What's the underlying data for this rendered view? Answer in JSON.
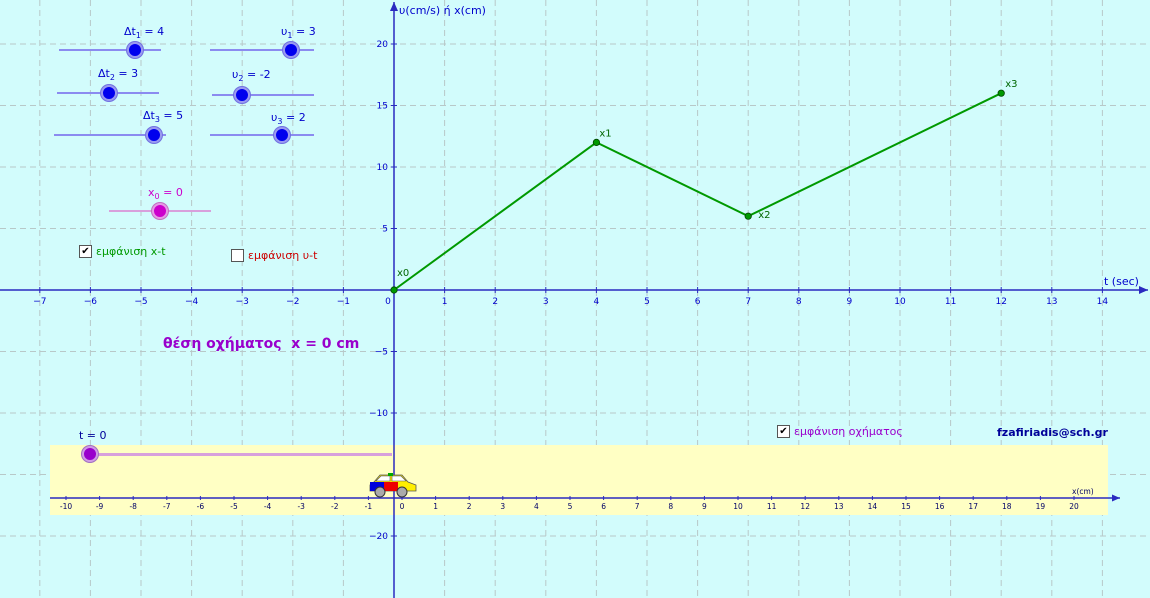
{
  "graph": {
    "y_axis_label": "υ(cm/s) ή x(cm)",
    "x_axis_label": "t (sec)",
    "x_ticks": [
      "−7",
      "−6",
      "−5",
      "−4",
      "−3",
      "−2",
      "−1",
      "0",
      "1",
      "2",
      "3",
      "4",
      "5",
      "6",
      "7",
      "8",
      "9",
      "10",
      "11",
      "12",
      "13",
      "14"
    ],
    "y_ticks": [
      "20",
      "15",
      "10",
      "5",
      "−5",
      "−10",
      "−20"
    ],
    "line_color": "#009900",
    "axis_color": "#2a2ac0",
    "background": "#d2fcfc"
  },
  "chart_data": {
    "type": "line",
    "x": [
      0,
      4,
      7,
      12
    ],
    "y": [
      0,
      12,
      6,
      16
    ],
    "point_labels": [
      "x0",
      "x1",
      "x2",
      "x3"
    ],
    "xlabel": "t (sec)",
    "ylabel": "υ(cm/s) ή x(cm)",
    "xlim": [
      -7.6,
      14.6
    ],
    "ylim": [
      -24.5,
      23.6
    ],
    "grid": true
  },
  "sliders": {
    "dt1": {
      "name": "Δt",
      "sub": "1",
      "value": "4"
    },
    "dt2": {
      "name": "Δt",
      "sub": "2",
      "value": "3"
    },
    "dt3": {
      "name": "Δt",
      "sub": "3",
      "value": "5"
    },
    "v1": {
      "name": "υ",
      "sub": "1",
      "value": "3"
    },
    "v2": {
      "name": "υ",
      "sub": "2",
      "value": "-2"
    },
    "v3": {
      "name": "υ",
      "sub": "3",
      "value": "2"
    },
    "x0": {
      "name": "x",
      "sub": "0",
      "value": "0"
    },
    "t": {
      "label": "t = 0"
    }
  },
  "checkboxes": {
    "show_xt": {
      "label": "εμφάνιση x-t",
      "checked": true,
      "color": "#009900"
    },
    "show_vt": {
      "label": "εμφάνιση υ-t",
      "checked": false,
      "color": "#cc0000"
    },
    "show_vehicle": {
      "label": "εμφάνιση οχήματος",
      "checked": true,
      "color": "#9900cc"
    }
  },
  "status": {
    "text": "θέση οχήματος  x = 0 cm"
  },
  "credit": {
    "text": "fzafiriadis@sch.gr"
  },
  "track": {
    "ticks": [
      "-10",
      "-9",
      "-8",
      "-7",
      "-6",
      "-5",
      "-4",
      "-3",
      "-2",
      "-1",
      "0",
      "1",
      "2",
      "3",
      "4",
      "5",
      "6",
      "7",
      "8",
      "9",
      "10",
      "11",
      "12",
      "13",
      "14",
      "15",
      "16",
      "17",
      "18",
      "19",
      "20"
    ],
    "axis_label": "x(cm)",
    "background": "#ffffc4",
    "vehicle_position": 0
  }
}
